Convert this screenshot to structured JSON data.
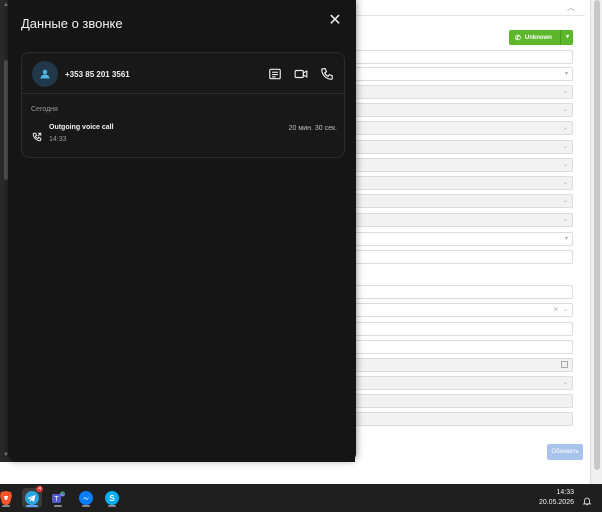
{
  "panel": {
    "title": "Данные о звонке",
    "contact": {
      "phone_number": "+353 85 201 3561"
    },
    "history": {
      "date_label": "Сегодня",
      "calls": [
        {
          "type": "Outgoing voice call",
          "time": "14:33",
          "duration": "20 мин. 30 сек."
        }
      ]
    }
  },
  "form": {
    "status_button": {
      "label": "Unknown",
      "color": "#5cb82a"
    },
    "update_button": {
      "label": "Обновить",
      "color": "#a9c4ec"
    }
  },
  "taskbar": {
    "apps": [
      {
        "name": "Brave browser",
        "icon": "brave-icon"
      },
      {
        "name": "Telegram",
        "icon": "telegram-icon",
        "badge": "4",
        "active": true
      },
      {
        "name": "Microsoft Teams",
        "icon": "teams-icon"
      },
      {
        "name": "Messenger",
        "icon": "messenger-icon"
      },
      {
        "name": "Skype",
        "icon": "skype-icon"
      }
    ],
    "clock": {
      "time": "14:33",
      "date": "20.05.2026"
    }
  },
  "colors": {
    "panel_bg": "#151515",
    "accent": "#4fb3e8",
    "text": "#f0f0f0"
  }
}
